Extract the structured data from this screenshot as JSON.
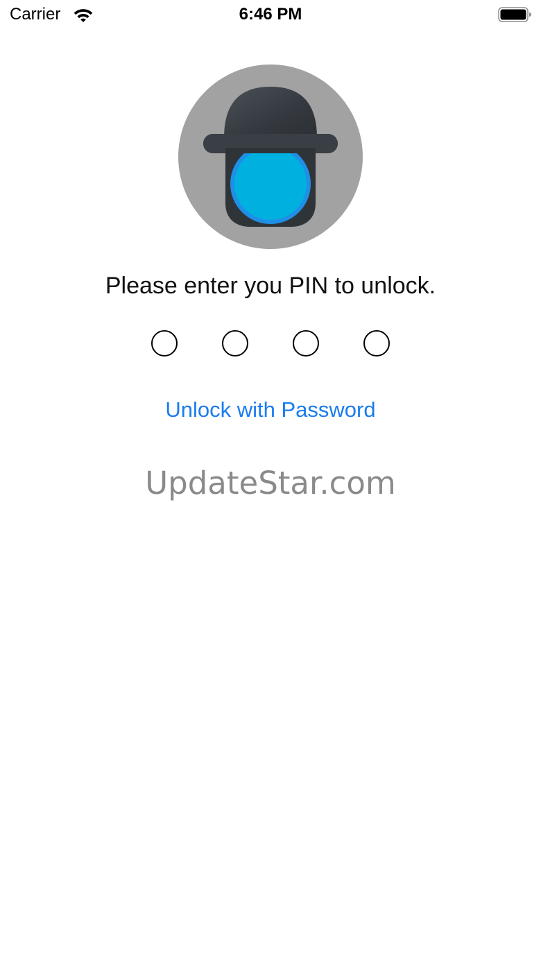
{
  "status_bar": {
    "carrier": "Carrier",
    "time": "6:46 PM",
    "wifi_icon": "wifi-icon",
    "battery_icon": "battery-icon"
  },
  "app_icon": {
    "icon": "bowler-hat-lock-icon",
    "colors": {
      "circle": "#a2a2a2",
      "hat": "#34393f",
      "lens": "#00b1df",
      "lens_ring": "#1f8fe6"
    }
  },
  "lock_screen": {
    "prompt": "Please enter you PIN to unlock.",
    "pin_length": 4,
    "pin_filled": 0,
    "unlock_password_label": "Unlock with Password",
    "link_color": "#1a7cf0"
  },
  "watermark": {
    "text": "UpdateStar.com"
  }
}
